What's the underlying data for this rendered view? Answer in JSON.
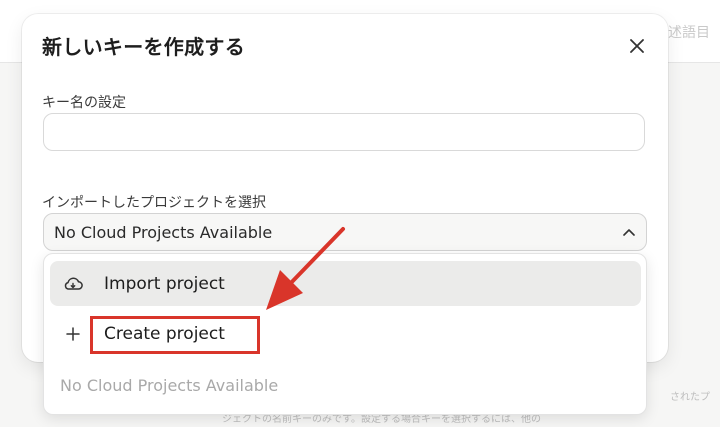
{
  "background": {
    "top_right_text": "述語目",
    "footer_text_1": "されたプ",
    "footer_text_2": "ジェクトの名前キーのみです。設定する場合キーを選択するには、他の"
  },
  "modal": {
    "title": "新しいキーを作成する",
    "close_icon": "close-icon",
    "name_label": "キー名の設定",
    "name_input": {
      "value": "",
      "placeholder": ""
    },
    "project_label": "インポートしたプロジェクトを選択",
    "project_select": {
      "value": "No Cloud Projects Available",
      "icon": "chevron-up-icon"
    }
  },
  "dropdown": {
    "items": [
      {
        "label": "Import project",
        "icon": "cloud-icon",
        "highlighted": true
      },
      {
        "label": "Create project",
        "icon": "plus-icon",
        "highlighted": false
      }
    ],
    "empty_text": "No Cloud Projects Available"
  },
  "annotation": {
    "color": "#d9352a"
  },
  "colors": {
    "accent": "#d9352a",
    "highlight_bg": "#ebebea",
    "muted_text": "#a9a9a9"
  }
}
